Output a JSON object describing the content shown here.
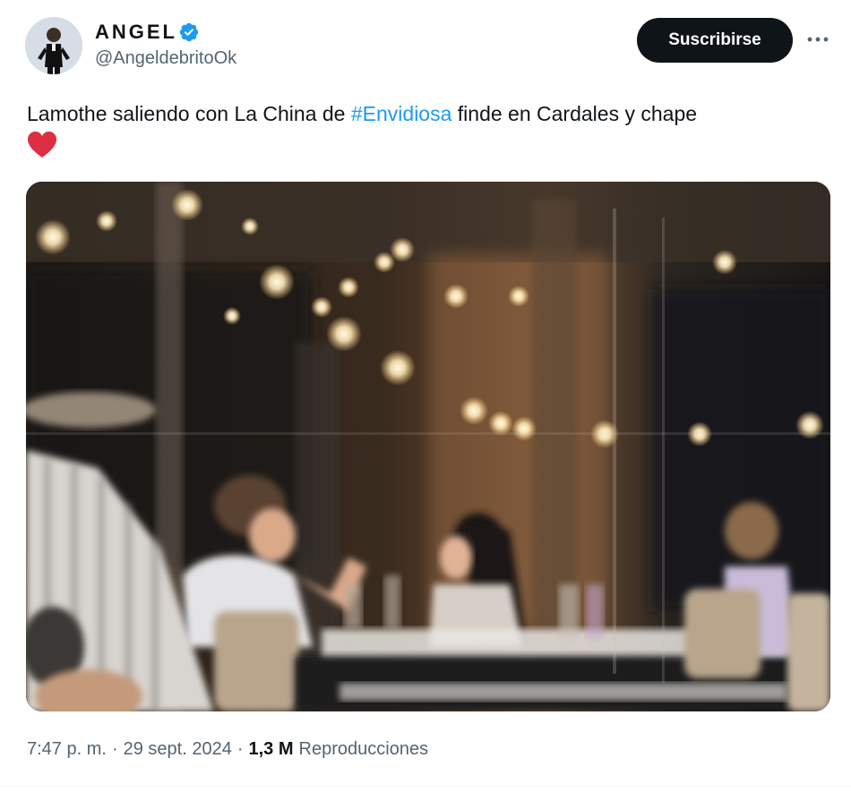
{
  "author": {
    "display_name": "ANGEL",
    "handle": "@AngeldebritoOk",
    "verified": true,
    "avatar_icon": "user-avatar"
  },
  "actions": {
    "subscribe_label": "Suscribirse",
    "more_icon": "more-horizontal-icon"
  },
  "tweet": {
    "text_before": "Lamothe saliendo con La China de ",
    "hashtag": "#Envidiosa",
    "text_after": " finde en Cardales y chape",
    "emoji_icon": "red-heart-icon"
  },
  "media": {
    "description_icon": "photo"
  },
  "meta": {
    "time": "7:47 p. m.",
    "separator": "·",
    "date": "29 sept. 2024",
    "views_count": "1,3 M",
    "views_label": "Reproducciones"
  },
  "colors": {
    "accent": "#1d9bf0",
    "text_primary": "#0f1419",
    "text_secondary": "#536471",
    "button_bg": "#0f1419",
    "heart": "#f91880"
  }
}
